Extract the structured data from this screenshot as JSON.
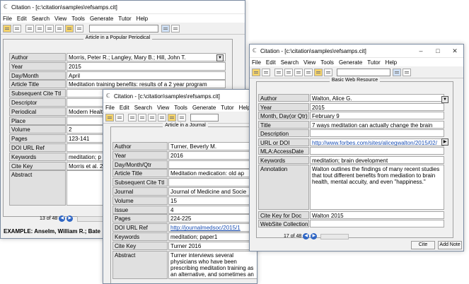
{
  "window1": {
    "title": "Citation - [c:\\citation\\samples\\refsamps.cit]",
    "menu": [
      "File",
      "Edit",
      "Search",
      "View",
      "Tools",
      "Generate",
      "Tutor",
      "Help"
    ],
    "group_title": "Article in a Popular Periodical",
    "fields": [
      {
        "label": "Author",
        "value": "Morris, Peter R.; Langley, Mary B.; Hill, John T."
      },
      {
        "label": "Year",
        "value": "2015"
      },
      {
        "label": "Day/Month",
        "value": "April"
      },
      {
        "label": "Article Title",
        "value": "Meditation training benefits: results of a 2 year program"
      },
      {
        "label": "Subsequent Cite Ttl",
        "value": ""
      },
      {
        "label": "Descriptor",
        "value": ""
      },
      {
        "label": "Periodical",
        "value": "Modern Healt"
      },
      {
        "label": "Place",
        "value": ""
      },
      {
        "label": "Volume",
        "value": "2"
      },
      {
        "label": "Pages",
        "value": "123-141"
      },
      {
        "label": "DOI URL Ref",
        "value": ""
      },
      {
        "label": "Keywords",
        "value": "meditation; p"
      },
      {
        "label": "Cite Key",
        "value": "Morris et al. 2"
      },
      {
        "label": "Abstract",
        "value": ""
      }
    ],
    "record_counter": "13 of 48",
    "example": "EXAMPLE: Anselm, William R.; Bate"
  },
  "window2": {
    "title": "Citation - [c:\\citation\\samples\\refsamps.cit]",
    "menu": [
      "File",
      "Edit",
      "Search",
      "View",
      "Tools",
      "Generate",
      "Tutor",
      "Help"
    ],
    "group_title": "Article in a Journal",
    "fields": [
      {
        "label": "Author",
        "value": "Turner, Beverly M."
      },
      {
        "label": "Year",
        "value": "2016"
      },
      {
        "label": "Day/Month/Qtr",
        "value": ""
      },
      {
        "label": "Article Title",
        "value": "Meditation medication: old ap"
      },
      {
        "label": "Subsequent Cite Ttl",
        "value": ""
      },
      {
        "label": "Journal",
        "value": "Journal of Medicine and Socie"
      },
      {
        "label": "Volume",
        "value": "15"
      },
      {
        "label": "Issue",
        "value": "4"
      },
      {
        "label": "Pages",
        "value": "224-225"
      },
      {
        "label": "DOI URL Ref",
        "value": "http://journalmedsoc/2015/1"
      },
      {
        "label": "Keywords",
        "value": "meditation; paper1"
      },
      {
        "label": "Cite Key",
        "value": "Turner 2016"
      },
      {
        "label": "Abstract",
        "value": "Turner interviews several physicians who have been prescribing meditation training as an alternative, and sometimes an added treatment strategy, for adults with ADD. The positive results they report is somewhat extraordinary."
      }
    ]
  },
  "window3": {
    "title": "Citation - [c:\\citation\\samples\\refsamps.cit]",
    "menu": [
      "File",
      "Edit",
      "Search",
      "View",
      "Tools",
      "Generate",
      "Tutor",
      "Help"
    ],
    "group_title": "Basic Web Resource",
    "fields": [
      {
        "label": "Author",
        "value": "Walton, Alice G."
      },
      {
        "label": "Year",
        "value": "2015"
      },
      {
        "label": "Month, Day(or Qtr)",
        "value": "February 9"
      },
      {
        "label": "Title",
        "value": "7 ways meditation can actually change the brain"
      },
      {
        "label": "Description",
        "value": ""
      },
      {
        "label": "URL or DOI",
        "value": "http://www.forbes.com/sites/alicegwalton/2015/02/"
      },
      {
        "label": "MLA:AccessDate",
        "value": ""
      },
      {
        "label": "Keywords",
        "value": "meditation; brain development"
      },
      {
        "label": "Annotation",
        "value": "Walton outlines the findings of many recent studies that tout different benefits from mediation to brain health, mental accuity, and even \"happiness.\""
      },
      {
        "label": "Cite Key for Doc",
        "value": "Walton 2015"
      },
      {
        "label": "WebSite Collection",
        "value": ""
      }
    ],
    "record_counter": "17 of 48",
    "cite_button": "Cite",
    "add_note_button": "Add Note"
  }
}
